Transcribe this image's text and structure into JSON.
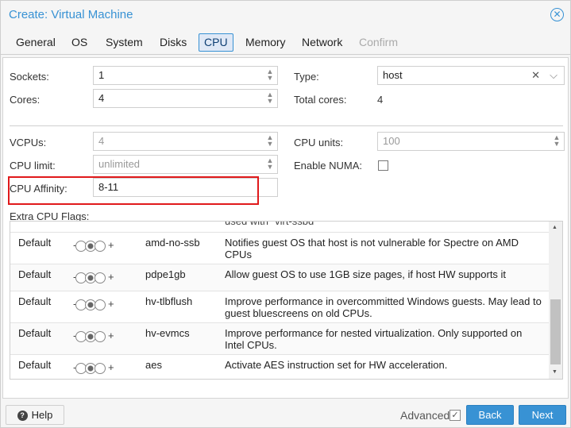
{
  "window": {
    "title": "Create: Virtual Machine"
  },
  "tabs": [
    {
      "label": "General"
    },
    {
      "label": "OS"
    },
    {
      "label": "System"
    },
    {
      "label": "Disks"
    },
    {
      "label": "CPU"
    },
    {
      "label": "Memory"
    },
    {
      "label": "Network"
    },
    {
      "label": "Confirm"
    }
  ],
  "active_tab": "CPU",
  "cpu": {
    "sockets_label": "Sockets:",
    "sockets_value": "1",
    "cores_label": "Cores:",
    "cores_value": "4",
    "type_label": "Type:",
    "type_value": "host",
    "total_cores_label": "Total cores:",
    "total_cores_value": "4",
    "vcpus_label": "VCPUs:",
    "vcpus_value": "4",
    "cpu_units_label": "CPU units:",
    "cpu_units_value": "100",
    "cpu_limit_label": "CPU limit:",
    "cpu_limit_value": "unlimited",
    "numa_label": "Enable NUMA:",
    "affinity_label": "CPU Affinity:",
    "affinity_value": "8-11",
    "extra_flags_label": "Extra CPU Flags:"
  },
  "flags_partial_text": "used with \"virt-ssbd\"",
  "flags": [
    {
      "state": "Default",
      "minus": "-",
      "plus": "+",
      "name": "amd-no-ssb",
      "desc": "Notifies guest OS that host is not vulnerable for Spectre on AMD CPUs"
    },
    {
      "state": "Default",
      "minus": "-",
      "plus": "+",
      "name": "pdpe1gb",
      "desc": "Allow guest OS to use 1GB size pages, if host HW supports it"
    },
    {
      "state": "Default",
      "minus": "-",
      "plus": "+",
      "name": "hv-tlbflush",
      "desc": "Improve performance in overcommitted Windows guests. May lead to guest bluescreens on old CPUs."
    },
    {
      "state": "Default",
      "minus": "-",
      "plus": "+",
      "name": "hv-evmcs",
      "desc": "Improve performance for nested virtualization. Only supported on Intel CPUs."
    },
    {
      "state": "Default",
      "minus": "-",
      "plus": "+",
      "name": "aes",
      "desc": "Activate AES instruction set for HW acceleration."
    }
  ],
  "footer": {
    "help_label": "Help",
    "advanced_label": "Advanced",
    "back_label": "Back",
    "next_label": "Next"
  },
  "colors": {
    "accent": "#3892d4",
    "highlight": "#e0191b"
  }
}
